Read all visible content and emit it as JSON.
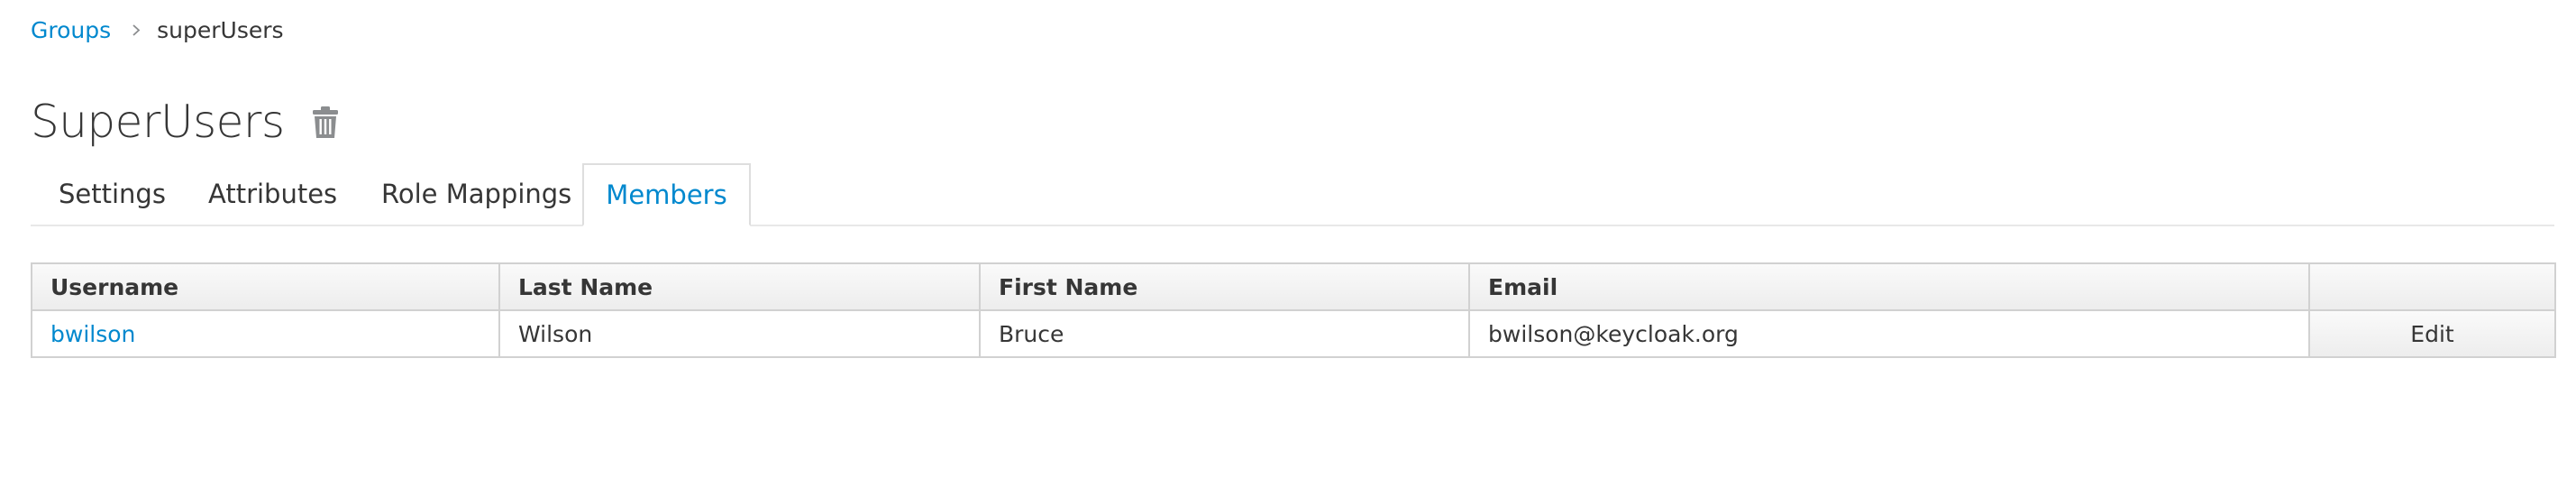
{
  "breadcrumb": {
    "parent_label": "Groups",
    "current_label": "superUsers"
  },
  "header": {
    "title": "SuperUsers",
    "delete_icon": "trash-icon"
  },
  "tabs": [
    {
      "label": "Settings",
      "active": false
    },
    {
      "label": "Attributes",
      "active": false
    },
    {
      "label": "Role Mappings",
      "active": false
    },
    {
      "label": "Members",
      "active": true
    }
  ],
  "members_table": {
    "columns": [
      "Username",
      "Last Name",
      "First Name",
      "Email",
      ""
    ],
    "rows": [
      {
        "username": "bwilson",
        "last_name": "Wilson",
        "first_name": "Bruce",
        "email": "bwilson@keycloak.org",
        "action_label": "Edit"
      }
    ]
  },
  "colors": {
    "link": "#0088ce",
    "text": "#363636",
    "border": "#d1d1d1",
    "icon": "#8b8d8f"
  }
}
